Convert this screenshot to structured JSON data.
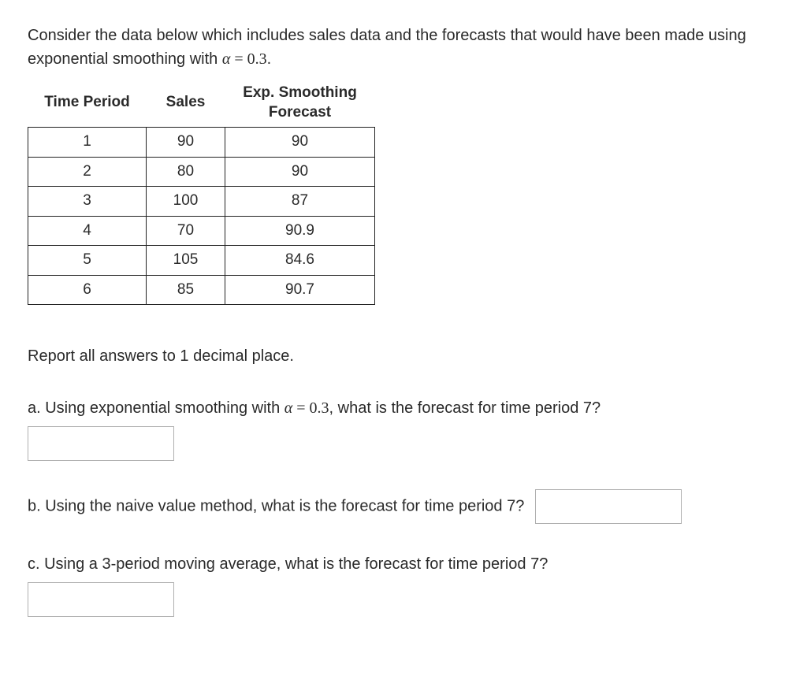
{
  "intro": {
    "text_before_alpha": "Consider the data below which includes sales data and the forecasts that would have been made using exponential smoothing with ",
    "alpha_expr": "α = 0.3",
    "text_after_alpha": "."
  },
  "table": {
    "headers": {
      "period": "Time Period",
      "sales": "Sales",
      "forecast_line1": "Exp. Smoothing",
      "forecast_line2": "Forecast"
    },
    "rows": [
      {
        "period": "1",
        "sales": "90",
        "forecast": "90"
      },
      {
        "period": "2",
        "sales": "80",
        "forecast": "90"
      },
      {
        "period": "3",
        "sales": "100",
        "forecast": "87"
      },
      {
        "period": "4",
        "sales": "70",
        "forecast": "90.9"
      },
      {
        "period": "5",
        "sales": "105",
        "forecast": "84.6"
      },
      {
        "period": "6",
        "sales": "85",
        "forecast": "90.7"
      }
    ]
  },
  "instruction": "Report all answers to 1 decimal place.",
  "questions": {
    "a": {
      "before_alpha": "a. Using exponential smoothing with  ",
      "alpha_expr": "α = 0.3",
      "after_alpha": ", what is the forecast for time period 7?"
    },
    "b": {
      "text": "b. Using the naive value method, what is the forecast for time period 7?"
    },
    "c": {
      "text": "c. Using a 3-period moving average, what is the forecast for time period 7?"
    }
  }
}
